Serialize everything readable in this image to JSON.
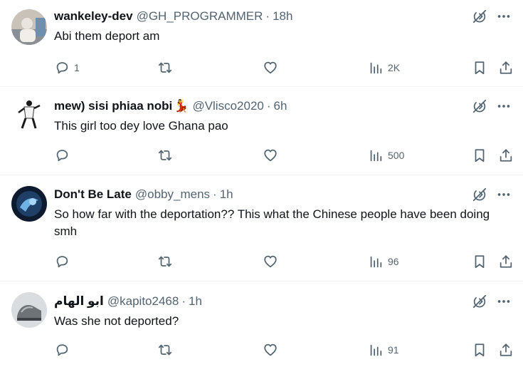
{
  "colors": {
    "text": "#0f1419",
    "muted": "#536471",
    "divider": "#eff3f4"
  },
  "replies": [
    {
      "name": "wankeley-dev",
      "name_emoji": "",
      "handle": "@GH_PROGRAMMER",
      "time": "18h",
      "text": "Abi them deport am",
      "reply_count": "1",
      "retweet_count": "",
      "like_count": "",
      "view_count": "2K"
    },
    {
      "name": "mew) sisi phiaa nobi",
      "name_emoji": "💃",
      "handle": "@Vlisco2020",
      "time": "6h",
      "text": "This girl too dey love Ghana pao",
      "reply_count": "",
      "retweet_count": "",
      "like_count": "",
      "view_count": "500"
    },
    {
      "name": "Don't Be Late",
      "name_emoji": "",
      "handle": "@obby_mens",
      "time": "1h",
      "text": "So how far with the deportation?? This what the Chinese people have been doing smh",
      "reply_count": "",
      "retweet_count": "",
      "like_count": "",
      "view_count": "96"
    },
    {
      "name": "ابو الهام",
      "name_emoji": "",
      "handle": "@kapito2468",
      "time": "1h",
      "text": "Was she not deported?",
      "reply_count": "",
      "retweet_count": "",
      "like_count": "",
      "view_count": "91"
    }
  ],
  "icons": {
    "grok": "grok-icon",
    "more": "more-icon",
    "reply": "reply-icon",
    "retweet": "retweet-icon",
    "like": "heart-icon",
    "views": "views-icon",
    "bookmark": "bookmark-icon",
    "share": "share-icon"
  }
}
